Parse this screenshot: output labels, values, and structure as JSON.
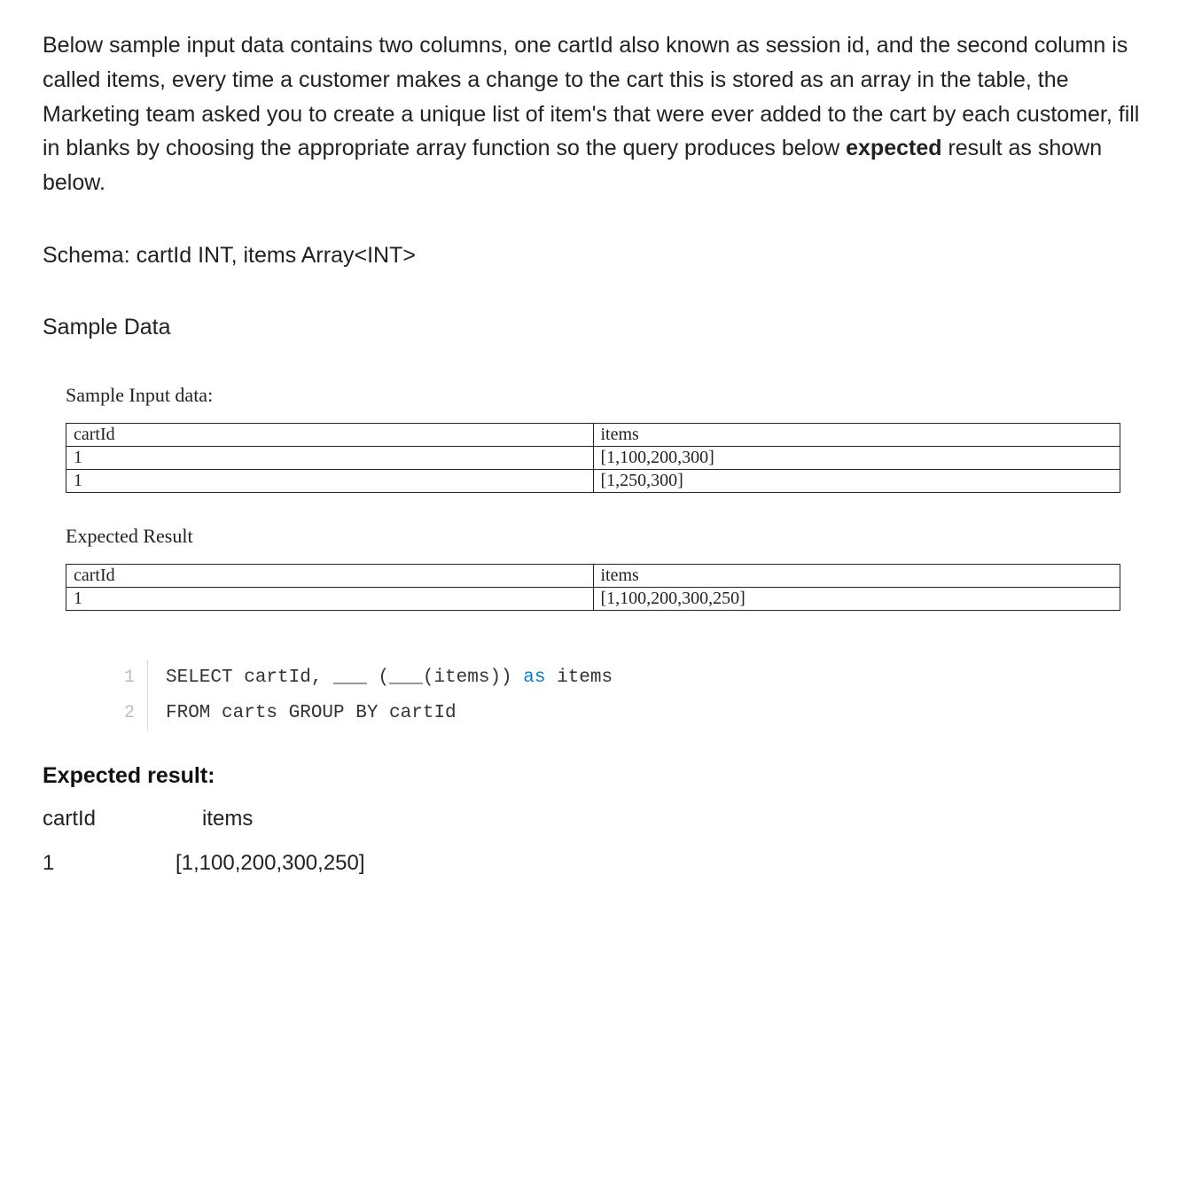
{
  "intro_parts": {
    "before_bold": "Below sample input data contains two columns, one cartId also known as session id, and the second column is called items, every time a customer makes a change to the cart this is stored as an array in the table, the Marketing team asked you to create a unique list of item's that were ever added to the cart by each customer, fill in blanks by choosing the appropriate array function so the query produces below ",
    "bold": "expected",
    "after_bold": " result as shown below."
  },
  "schema_line": "Schema: cartId INT, items Array<INT>",
  "sample_data_heading": "Sample Data",
  "sample_input_label": "Sample Input data:",
  "sample_table": {
    "headers": [
      "cartId",
      "items"
    ],
    "rows": [
      [
        "1",
        "[1,100,200,300]"
      ],
      [
        "1",
        "[1,250,300]"
      ]
    ]
  },
  "expected_result_label": "Expected Result",
  "expected_table": {
    "headers": [
      "cartId",
      "items"
    ],
    "rows": [
      [
        "1",
        "[1,100,200,300,250]"
      ]
    ]
  },
  "code": {
    "line1": {
      "num": "1",
      "pre_as": "SELECT cartId, ___ (___(items)) ",
      "as": "as",
      "post_as": " items"
    },
    "line2": {
      "num": "2",
      "text": "FROM carts GROUP BY cartId"
    }
  },
  "bottom_expected_heading": "Expected result:",
  "bottom_result": {
    "headers": [
      "cartId",
      "items"
    ],
    "row": [
      "1",
      "[1,100,200,300,250]"
    ]
  }
}
